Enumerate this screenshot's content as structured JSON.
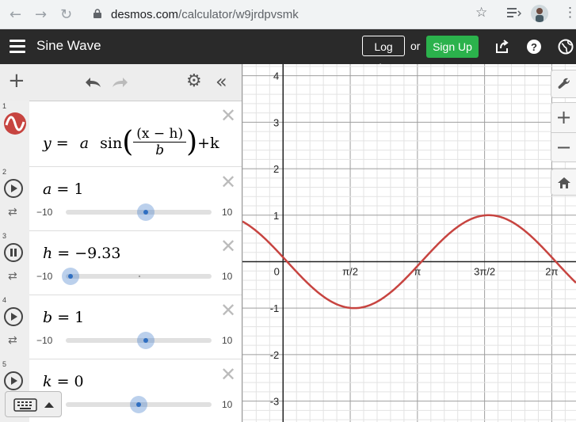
{
  "browser": {
    "url_domain": "desmos.com",
    "url_path": "/calculator/w9jrdpvsmk"
  },
  "header": {
    "title": "Sine Wave",
    "login_label": "Log In",
    "or_label": "or",
    "signup_label": "Sign Up"
  },
  "expressions": [
    {
      "number": "1",
      "lhs": "y",
      "eq": "=",
      "a": "a",
      "sin": "sin",
      "numerator": "(x − h)",
      "denominator": "b",
      "tail": "+k"
    },
    {
      "number": "2",
      "var": "a",
      "eq": "= 1",
      "min": "−10",
      "max": "10",
      "playing": false,
      "slider_fraction": 0.55
    },
    {
      "number": "3",
      "var": "h",
      "eq": "= −9.33",
      "min": "−10",
      "max": "10",
      "playing": true,
      "slider_fraction": 0.0335
    },
    {
      "number": "4",
      "var": "b",
      "eq": "= 1",
      "min": "−10",
      "max": "10",
      "playing": false,
      "slider_fraction": 0.55
    },
    {
      "number": "5",
      "var": "k",
      "eq": "= 0",
      "min": "",
      "max": "10",
      "playing": false,
      "slider_fraction": 0.5
    }
  ],
  "chart_data": {
    "type": "line",
    "function": "y = sin(x + 9.33)",
    "xlim": [
      -0.95,
      6.85
    ],
    "ylim": [
      -3.45,
      4.25
    ],
    "x_tick_labels": [
      "0",
      "π/2",
      "π",
      "3π/2",
      "2π"
    ],
    "x_tick_values": [
      0,
      1.5708,
      3.1416,
      4.7124,
      6.2832
    ],
    "y_tick_labels": [
      "4",
      "3",
      "2",
      "1",
      "-1",
      "-2",
      "-3"
    ],
    "y_tick_values": [
      4,
      3,
      2,
      1,
      -1,
      -2,
      -3
    ],
    "series": [
      {
        "params": {
          "a": 1,
          "h": -9.33,
          "b": 1,
          "k": 0
        },
        "color": "#c74440"
      }
    ],
    "grid": true
  },
  "colors": {
    "header_bg": "#2a2a2a",
    "signup_green": "#2bb24c",
    "curve_red": "#c74440",
    "slider_blue": "#2f6fc2"
  }
}
